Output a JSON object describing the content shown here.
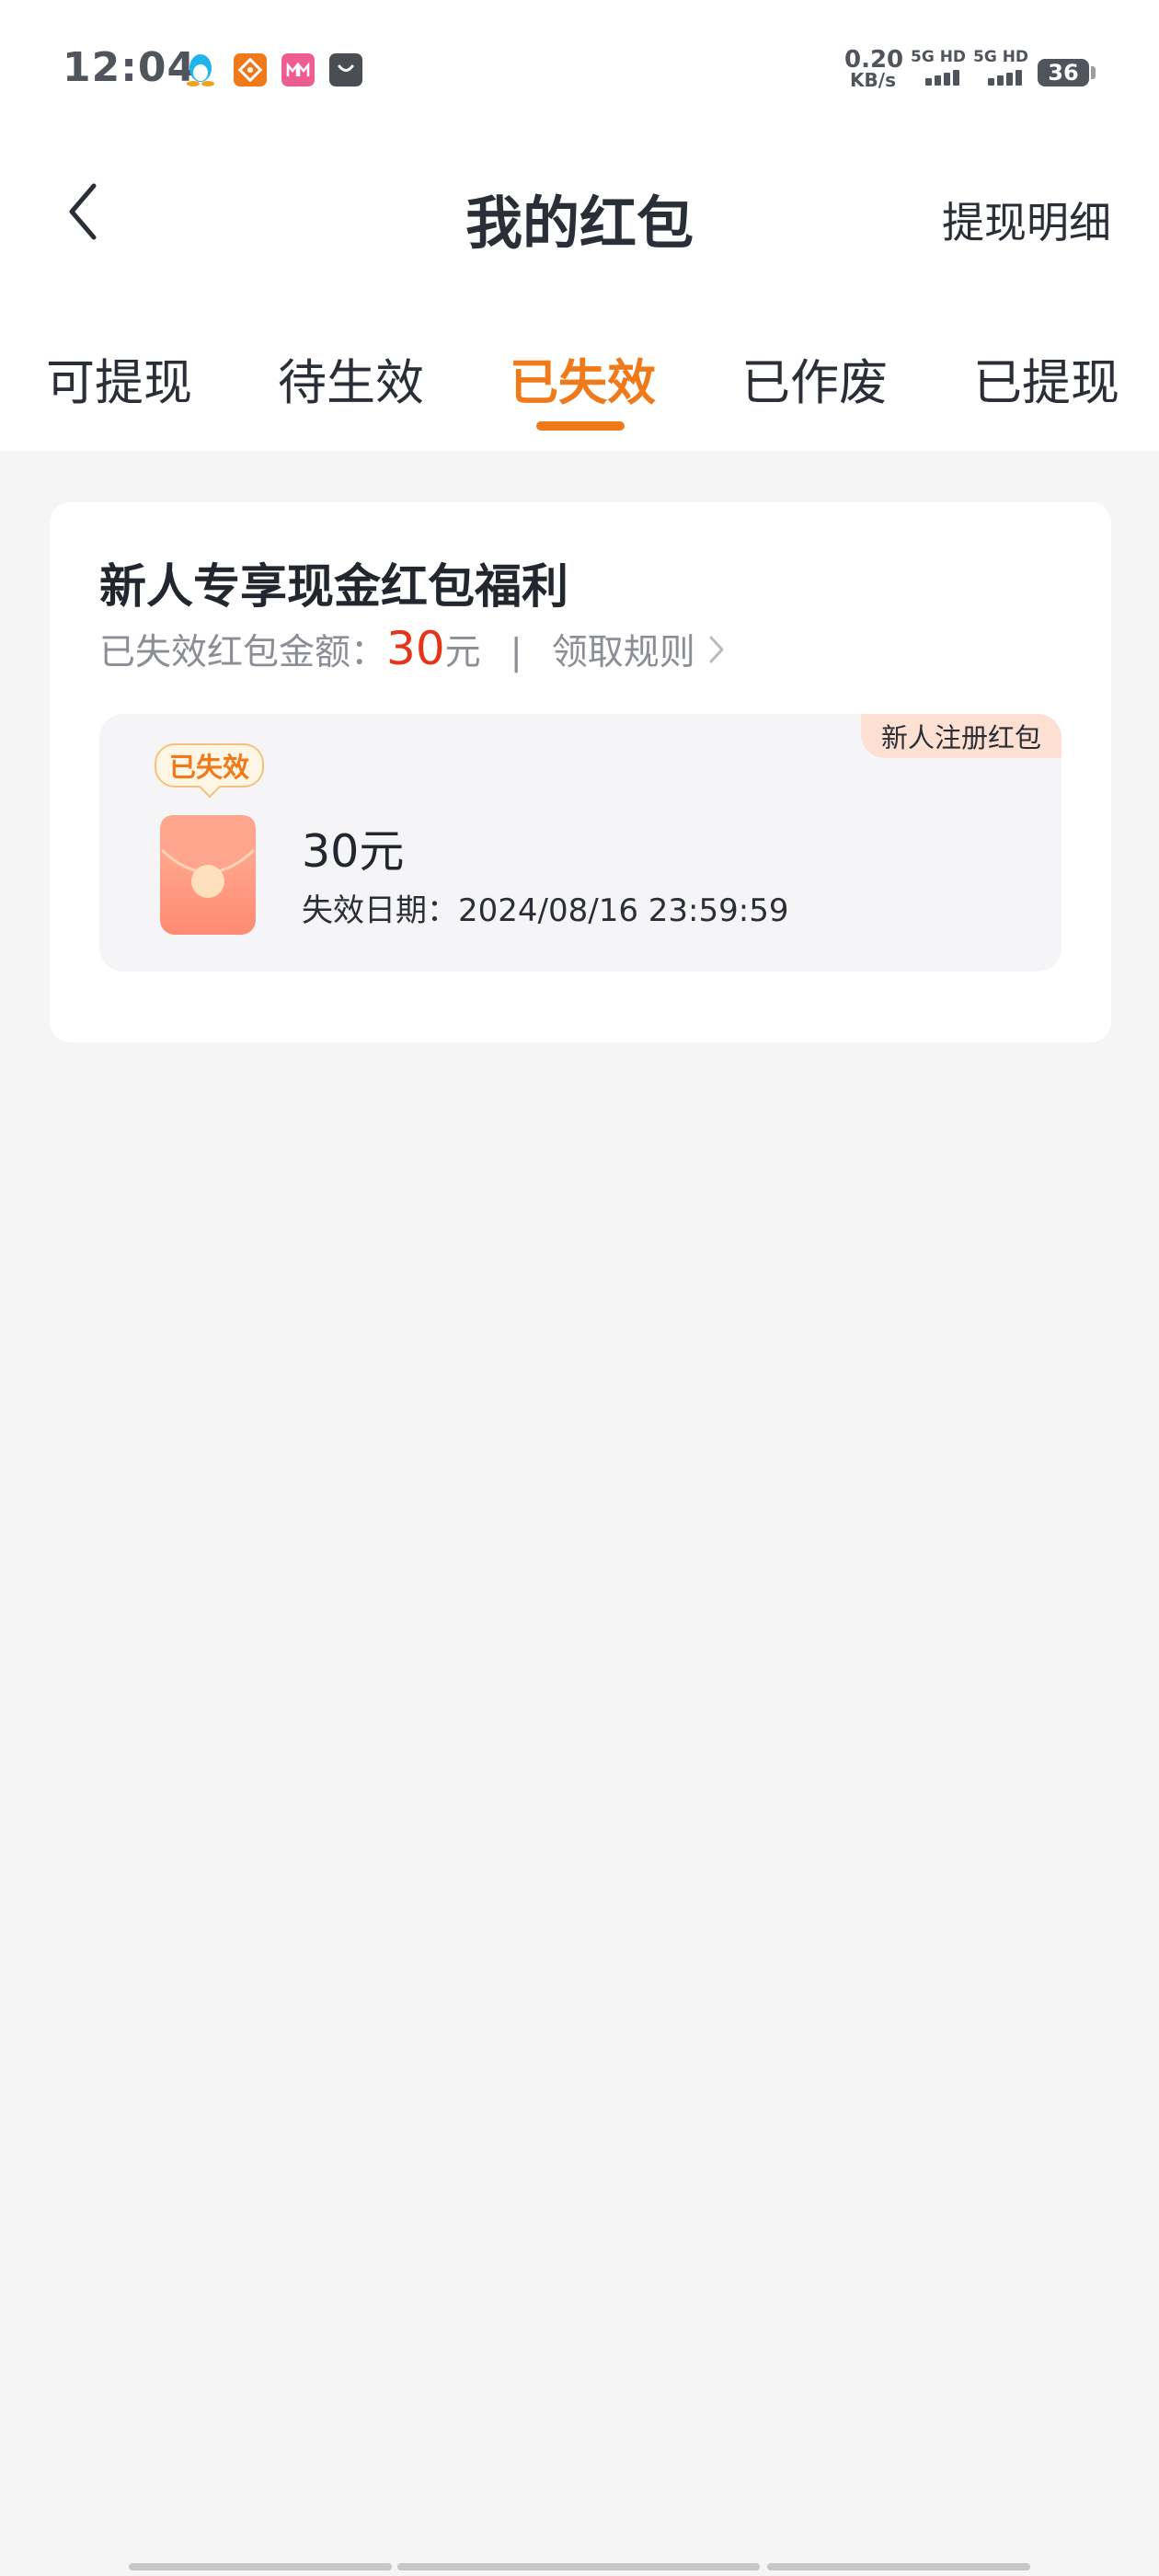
{
  "status_bar": {
    "time": "12:04",
    "net_speed_value": "0.20",
    "net_speed_unit": "KB/s",
    "signal_1_label": "5G HD",
    "signal_2_label": "5G HD",
    "battery": "36"
  },
  "header": {
    "title": "我的红包",
    "withdraw_detail": "提现明细"
  },
  "tabs": [
    {
      "label": "可提现",
      "active": false
    },
    {
      "label": "待生效",
      "active": false
    },
    {
      "label": "已失效",
      "active": true
    },
    {
      "label": "已作废",
      "active": false
    },
    {
      "label": "已提现",
      "active": false
    }
  ],
  "card": {
    "title": "新人专享现金红包福利",
    "summary_label": "已失效红包金额：",
    "summary_amount": "30",
    "summary_unit": "元",
    "divider": "|",
    "rules_label": "领取规则",
    "coupon": {
      "status": "已失效",
      "tag": "新人注册红包",
      "amount": "30元",
      "expiry": "失效日期：2024/08/16 23:59:59"
    }
  },
  "colors": {
    "accent": "#f07a1a",
    "amount_red": "#e53418",
    "background": "#f5f5f5"
  }
}
